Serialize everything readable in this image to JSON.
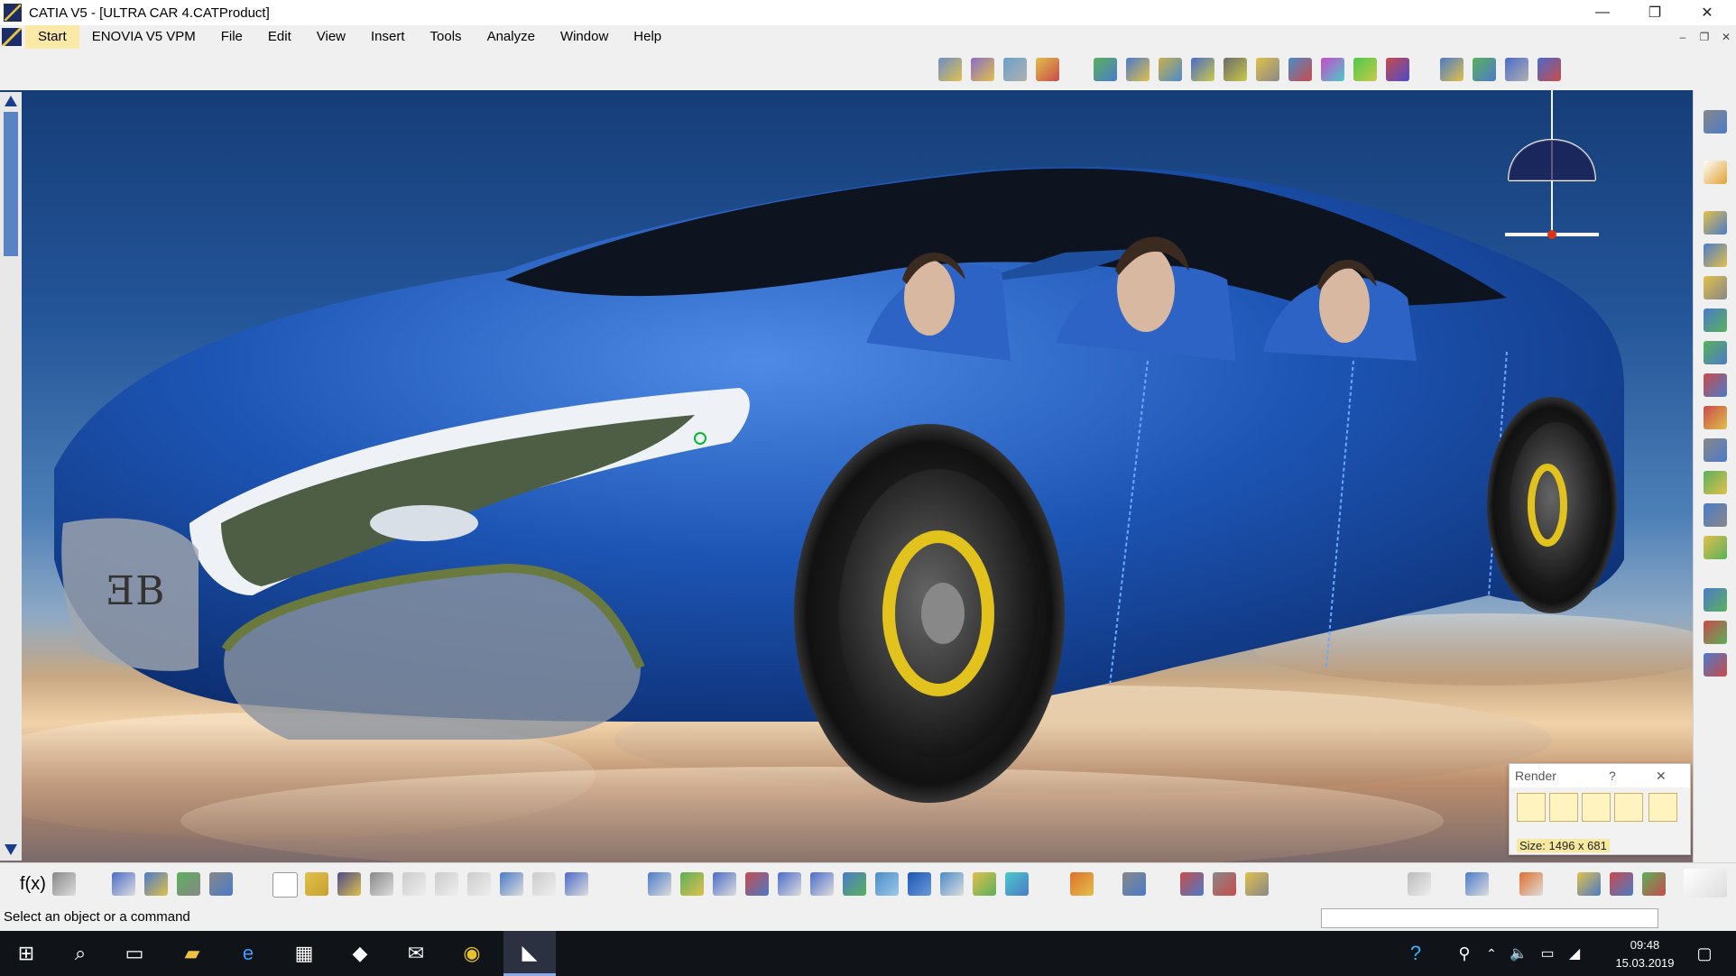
{
  "window": {
    "title": "CATIA V5 - [ULTRA CAR 4.CATProduct]",
    "minimize": "—",
    "restore": "❐",
    "close": "✕"
  },
  "menu": {
    "items": [
      "Start",
      "ENOVIA V5 VPM",
      "File",
      "Edit",
      "View",
      "Insert",
      "Tools",
      "Analyze",
      "Window",
      "Help"
    ],
    "mdi_min": "–",
    "mdi_restore": "❐",
    "mdi_close": "✕"
  },
  "render_dialog": {
    "title": "Render",
    "help": "?",
    "close": "✕",
    "size_text": "Size: 1496 x 681"
  },
  "status": {
    "message": "Select an object or a command"
  },
  "taskbar": {
    "time": "09:48",
    "date": "15.03.2019"
  },
  "colors": {
    "car_body": "#1d55b5",
    "accent_yellow": "#e2c21c",
    "menu_active": "#fbe9a8"
  }
}
